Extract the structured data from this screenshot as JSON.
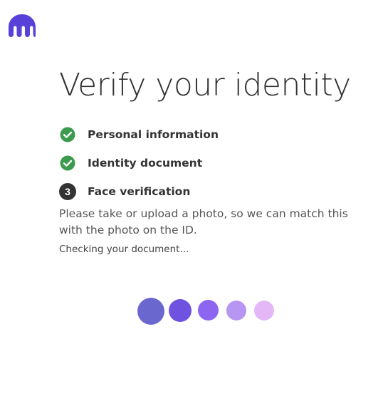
{
  "brand": {
    "logo_icon": "kraken-logo-icon",
    "accent_color": "#5741d9"
  },
  "title": "Verify your identity",
  "steps": [
    {
      "state": "done",
      "icon": "check-circle-icon",
      "label": "Personal information"
    },
    {
      "state": "done",
      "icon": "check-circle-icon",
      "label": "Identity document"
    },
    {
      "state": "current",
      "number": "3",
      "label": "Face verification"
    }
  ],
  "description": "Please take or upload a photo, so we can match this with the photo on the ID.",
  "status_text": "Checking your document...",
  "loader": {
    "colors": [
      "#6a67ce",
      "#7052e0",
      "#8c66f0",
      "#b795f2",
      "#e4b8f7"
    ]
  },
  "colors": {
    "check_green": "#3d9b4f"
  }
}
